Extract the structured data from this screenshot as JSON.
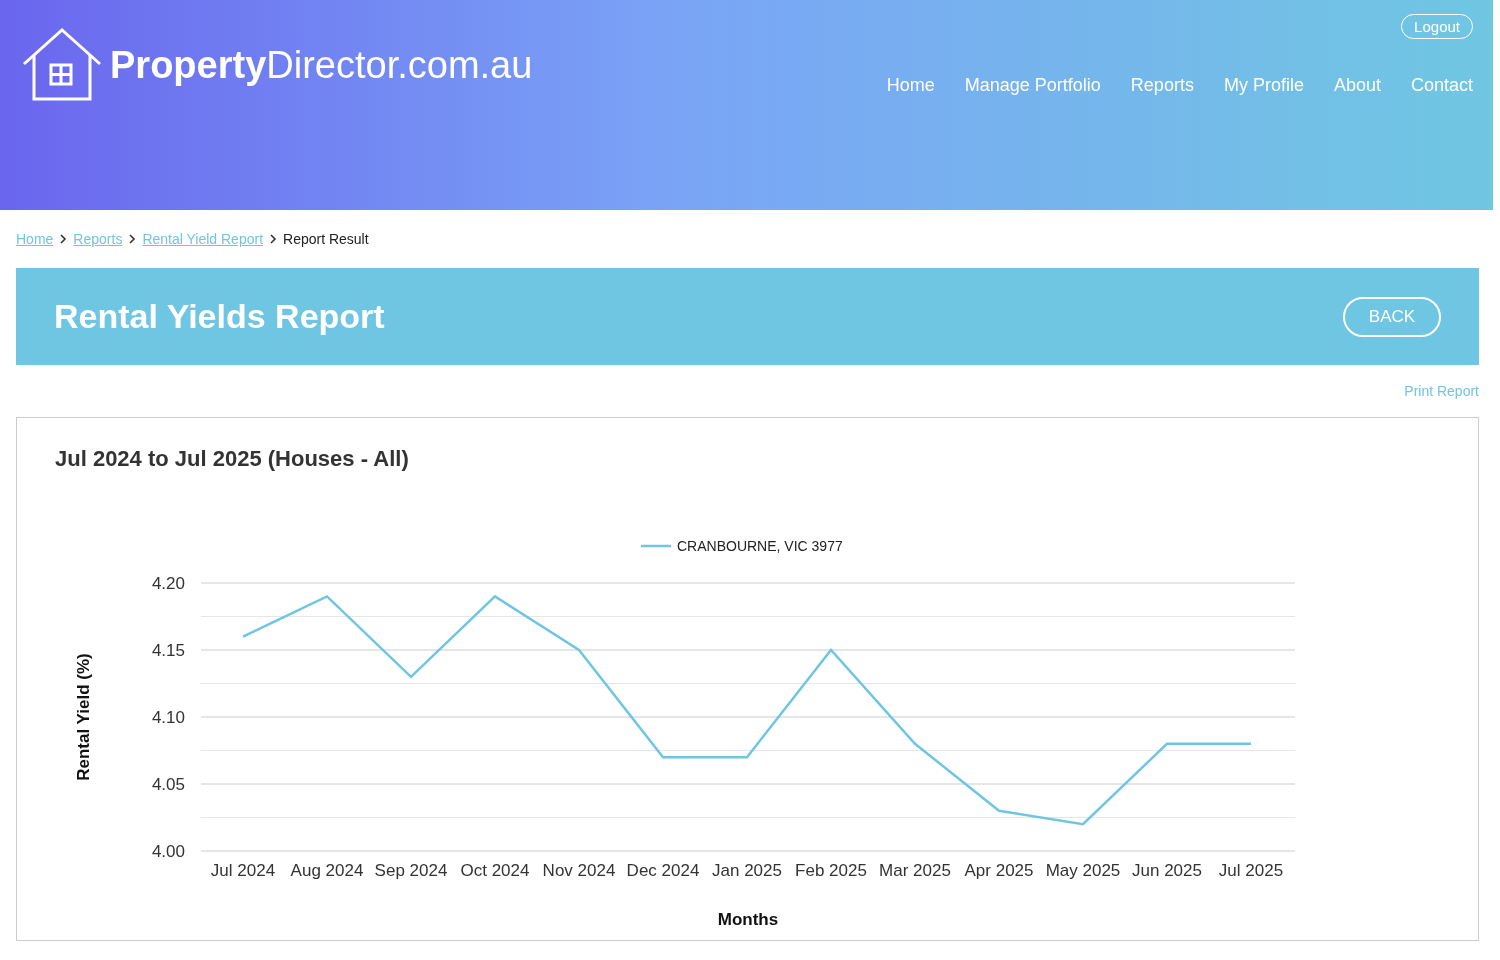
{
  "header": {
    "logo": {
      "bold": "Property",
      "light": "Director.com.au"
    },
    "logout": "Logout",
    "nav": [
      {
        "label": "Home"
      },
      {
        "label": "Manage Portfolio"
      },
      {
        "label": "Reports"
      },
      {
        "label": "My Profile"
      },
      {
        "label": "About"
      },
      {
        "label": "Contact"
      }
    ]
  },
  "breadcrumb": [
    {
      "label": "Home",
      "link": true
    },
    {
      "label": "Reports",
      "link": true
    },
    {
      "label": "Rental Yield Report",
      "link": true
    },
    {
      "label": "Report Result",
      "link": false
    }
  ],
  "banner": {
    "title": "Rental Yields Report",
    "button": "BACK"
  },
  "print_link": "Print Report",
  "report": {
    "title": "Jul 2024 to Jul 2025 (Houses - All)",
    "chart_data": {
      "type": "line",
      "xlabel": "Months",
      "ylabel": "Rental Yield (%)",
      "categories": [
        "Jul 2024",
        "Aug 2024",
        "Sep 2024",
        "Oct 2024",
        "Nov 2024",
        "Dec 2024",
        "Jan 2025",
        "Feb 2025",
        "Mar 2025",
        "Apr 2025",
        "May 2025",
        "Jun 2025",
        "Jul 2025"
      ],
      "series": [
        {
          "name": "CRANBOURNE, VIC 3977",
          "color": "#6ec6e2",
          "values": [
            4.16,
            4.19,
            4.13,
            4.19,
            4.15,
            4.07,
            4.07,
            4.15,
            4.08,
            4.03,
            4.02,
            4.08,
            4.08
          ]
        }
      ],
      "ylim": [
        4.0,
        4.2
      ],
      "grid": true,
      "yticks": [
        {
          "value": 4.0,
          "label": "4.00"
        },
        {
          "value": 4.05,
          "label": "4.05"
        },
        {
          "value": 4.1,
          "label": "4.10"
        },
        {
          "value": 4.15,
          "label": "4.15"
        },
        {
          "value": 4.2,
          "label": "4.20"
        }
      ]
    }
  }
}
